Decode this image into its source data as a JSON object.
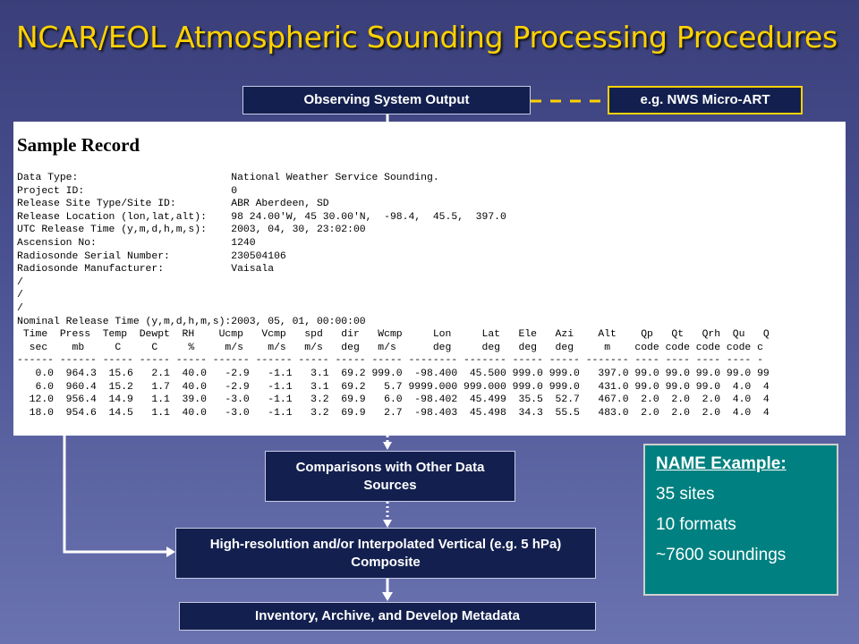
{
  "title": "NCAR/EOL Atmospheric Sounding Processing Procedures",
  "boxes": {
    "observing_output": "Observing System Output",
    "example": "e.g. NWS Micro-ART",
    "comparisons": "Comparisons with Other Data Sources",
    "high_res": "High-resolution and/or Interpolated Vertical (e.g. 5 hPa) Composite",
    "inventory": "Inventory, Archive, and Develop Metadata"
  },
  "sample_record": {
    "title": "Sample Record",
    "lines": [
      "Data Type:                         National Weather Service Sounding.",
      "Project ID:                        0",
      "Release Site Type/Site ID:         ABR Aberdeen, SD",
      "Release Location (lon,lat,alt):    98 24.00'W, 45 30.00'N,  -98.4,  45.5,  397.0",
      "UTC Release Time (y,m,d,h,m,s):    2003, 04, 30, 23:02:00",
      "Ascension No:                      1240",
      "Radiosonde Serial Number:          230504106",
      "Radiosonde Manufacturer:           Vaisala",
      "/",
      "/",
      "/",
      "Nominal Release Time (y,m,d,h,m,s):2003, 05, 01, 00:00:00",
      " Time  Press  Temp  Dewpt  RH    Ucmp   Vcmp   spd   dir   Wcmp     Lon     Lat   Ele   Azi    Alt    Qp   Qt   Qrh  Qu   Q",
      "  sec    mb     C     C     %     m/s    m/s   m/s   deg   m/s      deg     deg   deg   deg     m    code code code code c",
      "------ ------ ----- ----- ----- ------ ------ ----- ----- ----- -------- ------- ----- ----- ------- ---- ---- ---- ---- -",
      "   0.0  964.3  15.6   2.1  40.0   -2.9   -1.1   3.1  69.2 999.0  -98.400  45.500 999.0 999.0   397.0 99.0 99.0 99.0 99.0 99",
      "   6.0  960.4  15.2   1.7  40.0   -2.9   -1.1   3.1  69.2   5.7 9999.000 999.000 999.0 999.0   431.0 99.0 99.0 99.0  4.0  4",
      "  12.0  956.4  14.9   1.1  39.0   -3.0   -1.1   3.2  69.9   6.0  -98.402  45.499  35.5  52.7   467.0  2.0  2.0  2.0  4.0  4",
      "  18.0  954.6  14.5   1.1  40.0   -3.0   -1.1   3.2  69.9   2.7  -98.403  45.498  34.3  55.5   483.0  2.0  2.0  2.0  4.0  4"
    ]
  },
  "name_example": {
    "title": "NAME Example:",
    "items": [
      "35 sites",
      "10 formats",
      "~7600 soundings"
    ]
  },
  "colors": {
    "title": "#ffd200",
    "box_fill": "#13204f",
    "name_box_fill": "#008080",
    "connector": "#ffffff",
    "dashed_link": "#ffd200"
  }
}
